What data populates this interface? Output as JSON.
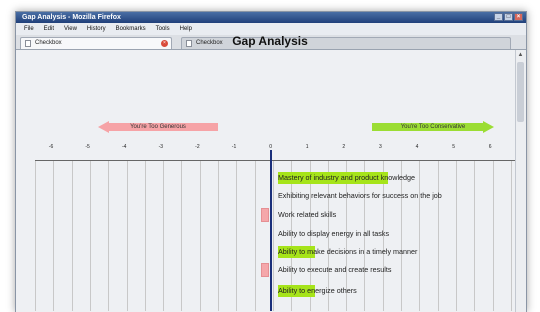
{
  "window": {
    "title": "Gap Analysis - Mozilla Firefox",
    "controls": [
      "_",
      "□",
      "×"
    ]
  },
  "menu": [
    "File",
    "Edit",
    "View",
    "History",
    "Bookmarks",
    "Tools",
    "Help"
  ],
  "tabs": [
    {
      "label": "Checkbox",
      "active": true
    },
    {
      "label": "Checkbox",
      "active": false
    }
  ],
  "page": {
    "title": "Gap Analysis",
    "left_arrow_label": "You're Too Generous",
    "right_arrow_label": "You're Too Conservative",
    "scale": [
      "-6",
      "-5",
      "-4",
      "-3",
      "-2",
      "-1",
      "0",
      "1",
      "2",
      "3",
      "4",
      "5",
      "6"
    ],
    "colors": {
      "positive_highlight": "#a6e41a",
      "negative_marker": "#f5a7aa",
      "center_line": "#1a2f7a"
    },
    "items": [
      {
        "text": "Mastery of industry and product knowledge",
        "gap": 3
      },
      {
        "text": "Exhibiting relevant behaviors for success on the job",
        "gap": 0
      },
      {
        "text": "Work related skills",
        "gap": -1
      },
      {
        "text": "Ability to display energy in all tasks",
        "gap": 0
      },
      {
        "text": "Ability to make decisions in a timely manner",
        "gap": 1
      },
      {
        "text": "Ability to execute and create results",
        "gap": -1
      },
      {
        "text": "Ability to energize others",
        "gap": 1
      }
    ]
  }
}
